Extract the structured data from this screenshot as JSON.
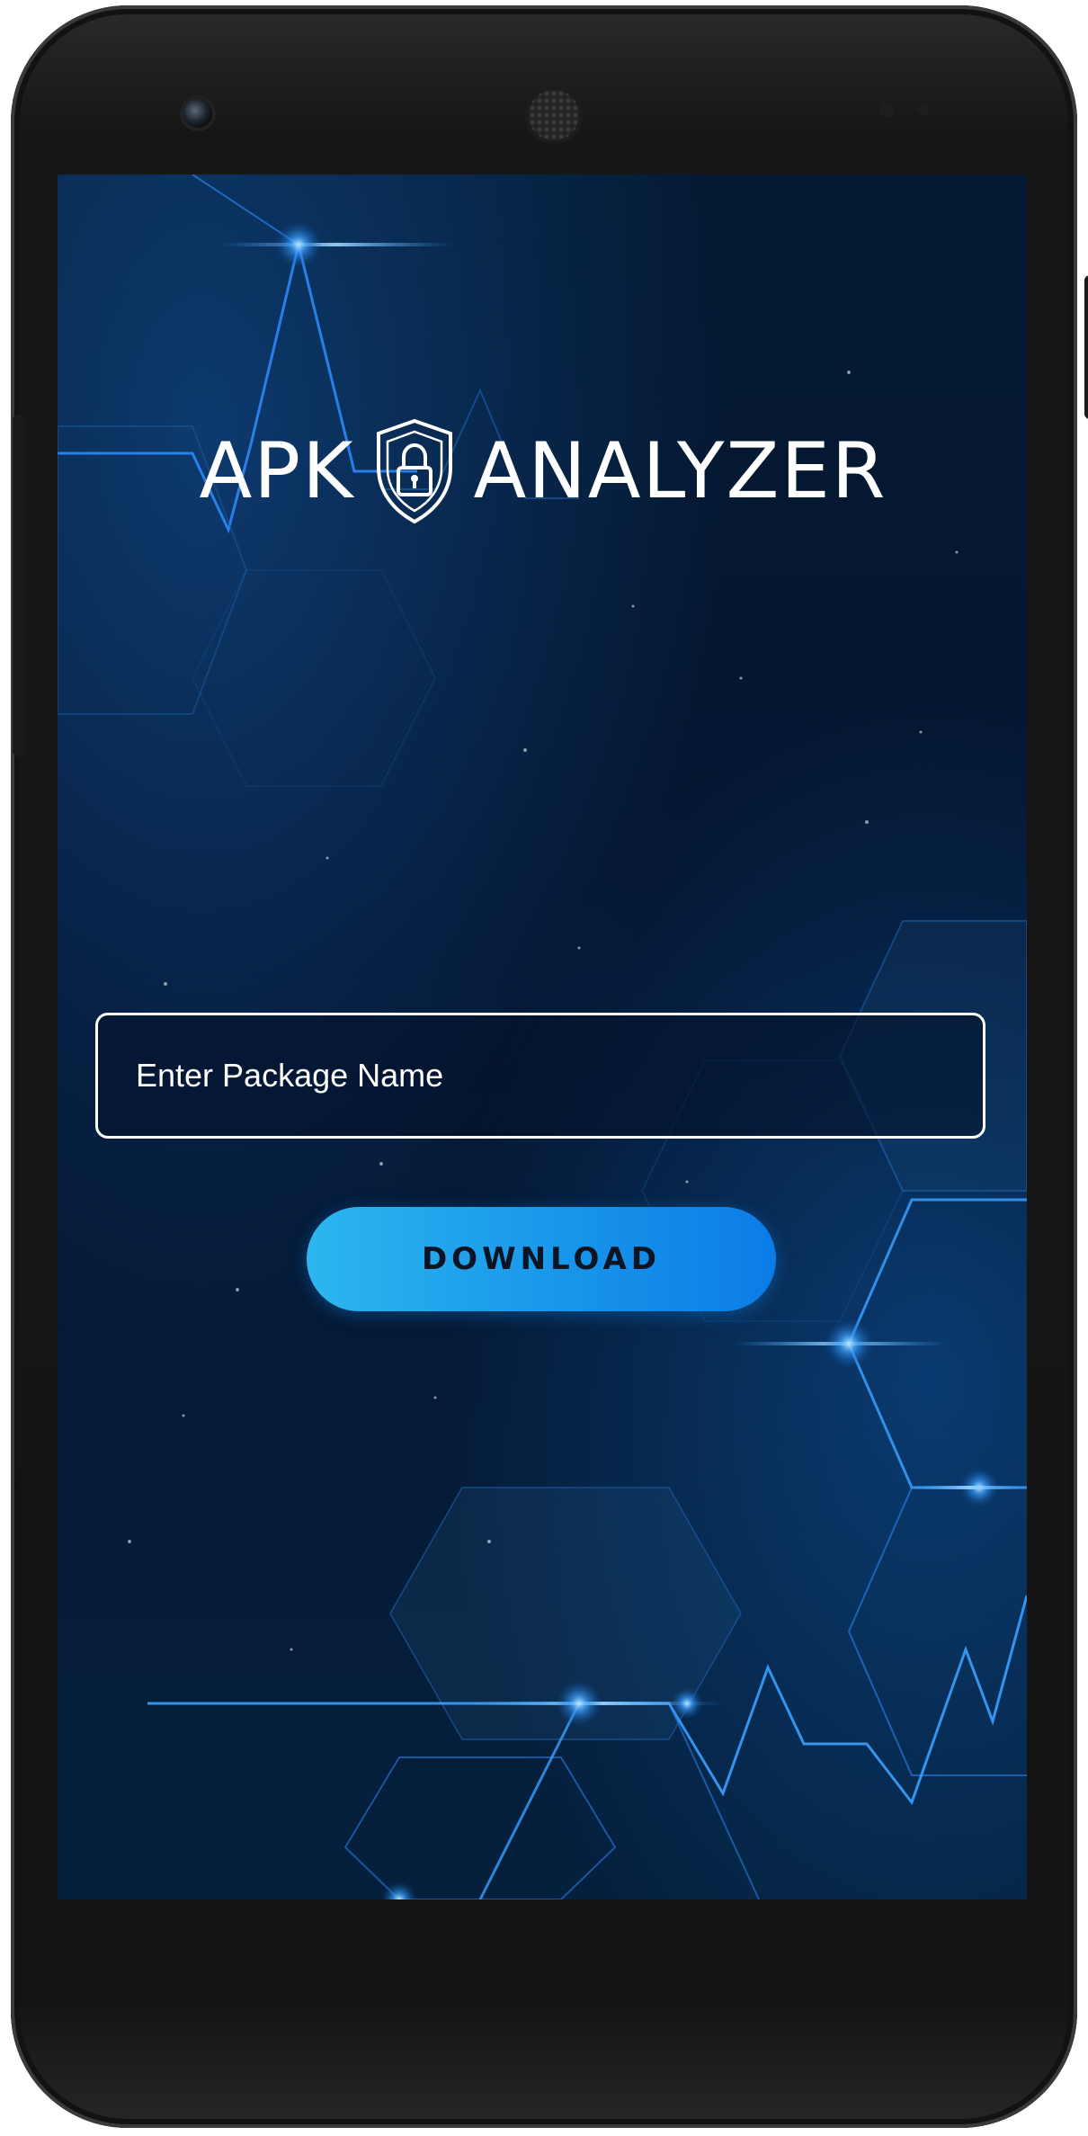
{
  "app": {
    "logo_left": "APK",
    "logo_right": "ANALYZER",
    "logo_icon": "shield-lock-icon"
  },
  "form": {
    "package_input": {
      "placeholder": "Enter Package Name",
      "value": ""
    },
    "download_label": "DOWNLOAD"
  },
  "colors": {
    "background": "#041a33",
    "accent": "#1a98ea",
    "button_gradient_start": "#2cb6ee",
    "button_gradient_end": "#0b7ce6",
    "text": "#ffffff"
  }
}
